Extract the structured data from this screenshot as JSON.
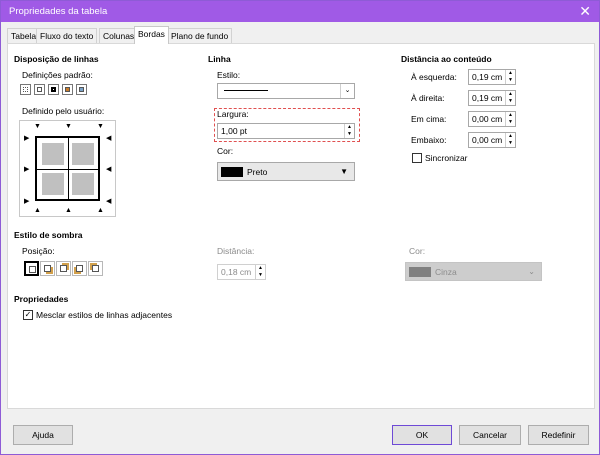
{
  "window": {
    "title": "Propriedades da tabela",
    "close_glyph": "✕"
  },
  "tabs": [
    {
      "label": "Tabela",
      "active": false
    },
    {
      "label": "Fluxo do texto",
      "active": false
    },
    {
      "label": "Colunas",
      "active": false
    },
    {
      "label": "Bordas",
      "active": true
    },
    {
      "label": "Plano de fundo",
      "active": false
    }
  ],
  "line_arrangement": {
    "heading": "Disposição de linhas",
    "presets_label": "Definições padrão:",
    "user_label": "Definido pelo usuário:",
    "preset_icons": [
      "no-borders-icon",
      "outer-border-icon",
      "outer-and-horizontal-icon",
      "outer-and-all-inner-icon",
      "outer-border-only-icon"
    ]
  },
  "line": {
    "heading": "Linha",
    "style_label": "Estilo:",
    "width_label": "Largura:",
    "width_value": "1,00 pt",
    "color_label": "Cor:",
    "color_name": "Preto",
    "color_value": "#000000"
  },
  "spacing": {
    "heading": "Distância ao conteúdo",
    "left_label": "À esquerda:",
    "left_value": "0,19 cm",
    "right_label": "À direita:",
    "right_value": "0,19 cm",
    "top_label": "Em cima:",
    "top_value": "0,00 cm",
    "bottom_label": "Embaixo:",
    "bottom_value": "0,00 cm",
    "sync_label": "Sincronizar",
    "sync_checked": false
  },
  "shadow": {
    "heading": "Estilo de sombra",
    "position_label": "Posição:",
    "distance_label": "Distância:",
    "distance_value": "0,18 cm",
    "color_label": "Cor:",
    "color_name": "Cinza",
    "color_value": "#808080",
    "position_icons": [
      "no-shadow-icon",
      "shadow-bottom-right-icon",
      "shadow-top-right-icon",
      "shadow-bottom-left-icon",
      "shadow-top-left-icon"
    ]
  },
  "properties": {
    "heading": "Propriedades",
    "merge_label": "Mesclar estilos de linhas adjacentes",
    "merge_checked": true
  },
  "buttons": {
    "help": "Ajuda",
    "ok": "OK",
    "cancel": "Cancelar",
    "reset": "Redefinir"
  },
  "glyphs": {
    "check": "✓",
    "dropdown": "▼",
    "chevron": "⌄",
    "up": "▲",
    "down": "▼"
  }
}
